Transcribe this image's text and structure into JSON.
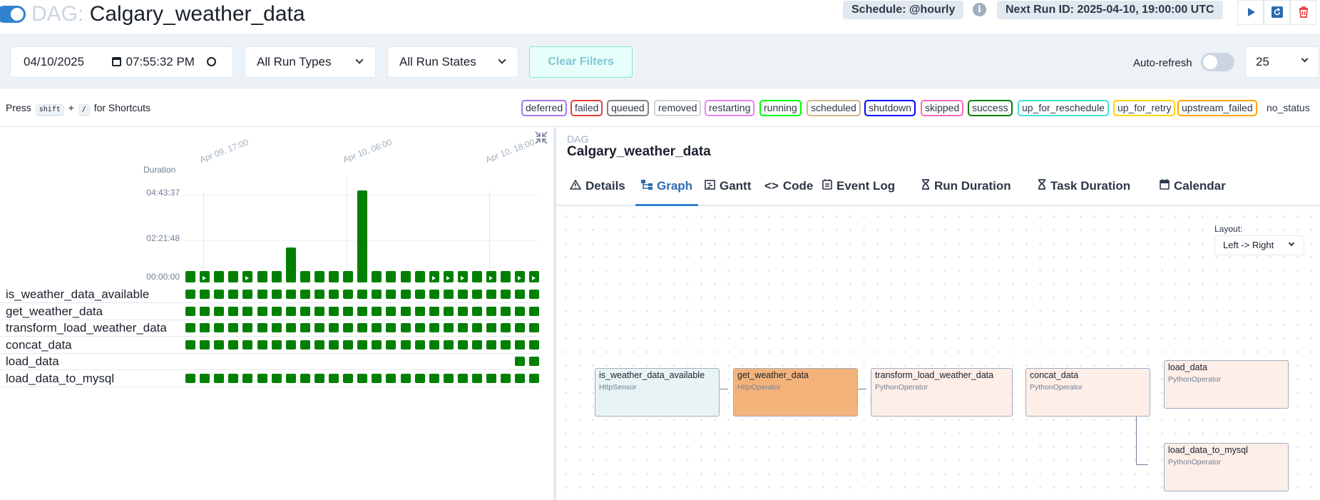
{
  "header": {
    "dag_label": "DAG:",
    "dag_id": "Calgary_weather_data",
    "schedule": "Schedule: @hourly",
    "next_run": "Next Run ID: 2025-04-10, 19:00:00 UTC",
    "info_icon": "i",
    "actions": [
      "play-icon",
      "reparse-icon",
      "delete-icon"
    ],
    "paused": false
  },
  "filters": {
    "date": "04/10/2025",
    "time": "07:55:32 PM",
    "run_types": "All Run Types",
    "run_states": "All Run States",
    "clear_label": "Clear Filters",
    "auto_refresh_label": "Auto-refresh",
    "auto_refresh_on": false,
    "num_runs": "25"
  },
  "shortcuts": {
    "press": "Press",
    "key1": "shift",
    "plus": "+",
    "key2": "/",
    "suffix": "for Shortcuts"
  },
  "legend": [
    {
      "label": "deferred",
      "color": "#9f7aea"
    },
    {
      "label": "failed",
      "color": "#e53e3e"
    },
    {
      "label": "queued",
      "color": "#808080"
    },
    {
      "label": "removed",
      "color": "#d3d3d3"
    },
    {
      "label": "restarting",
      "color": "#ee82ee"
    },
    {
      "label": "running",
      "color": "#00ff00"
    },
    {
      "label": "scheduled",
      "color": "#d2b48c"
    },
    {
      "label": "shutdown",
      "color": "#0000ff"
    },
    {
      "label": "skipped",
      "color": "#ff69b4"
    },
    {
      "label": "success",
      "color": "#008000"
    },
    {
      "label": "up_for_reschedule",
      "color": "#40e0d0"
    },
    {
      "label": "up_for_retry",
      "color": "#ffd700"
    },
    {
      "label": "upstream_failed",
      "color": "#ffa500"
    },
    {
      "label": "no_status",
      "color": ""
    }
  ],
  "grid": {
    "duration_label": "Duration",
    "y_ticks": [
      "04:43:37",
      "02:21:48",
      "00:00:00"
    ],
    "x_ticks": [
      "Apr 09, 17:00",
      "Apr 10, 06:00",
      "Apr 10, 18:00"
    ],
    "run_bars": [
      {
        "state": "success",
        "duration_frac": 0.07,
        "scheduled_icon": false
      },
      {
        "state": "success",
        "duration_frac": 0.07,
        "scheduled_icon": true
      },
      {
        "state": "success",
        "duration_frac": 0.07,
        "scheduled_icon": false
      },
      {
        "state": "success",
        "duration_frac": 0.07,
        "scheduled_icon": false
      },
      {
        "state": "success",
        "duration_frac": 0.07,
        "scheduled_icon": true
      },
      {
        "state": "success",
        "duration_frac": 0.07,
        "scheduled_icon": false
      },
      {
        "state": "success",
        "duration_frac": 0.07,
        "scheduled_icon": false
      },
      {
        "state": "success",
        "duration_frac": 0.38,
        "scheduled_icon": false
      },
      {
        "state": "success",
        "duration_frac": 0.07,
        "scheduled_icon": false
      },
      {
        "state": "success",
        "duration_frac": 0.07,
        "scheduled_icon": false
      },
      {
        "state": "success",
        "duration_frac": 0.07,
        "scheduled_icon": false
      },
      {
        "state": "success",
        "duration_frac": 0.07,
        "scheduled_icon": false
      },
      {
        "state": "success",
        "duration_frac": 0.99,
        "scheduled_icon": false
      },
      {
        "state": "success",
        "duration_frac": 0.07,
        "scheduled_icon": false
      },
      {
        "state": "success",
        "duration_frac": 0.07,
        "scheduled_icon": false
      },
      {
        "state": "success",
        "duration_frac": 0.07,
        "scheduled_icon": false
      },
      {
        "state": "success",
        "duration_frac": 0.07,
        "scheduled_icon": false
      },
      {
        "state": "success",
        "duration_frac": 0.07,
        "scheduled_icon": true
      },
      {
        "state": "success",
        "duration_frac": 0.07,
        "scheduled_icon": true
      },
      {
        "state": "success",
        "duration_frac": 0.07,
        "scheduled_icon": true
      },
      {
        "state": "success",
        "duration_frac": 0.07,
        "scheduled_icon": false
      },
      {
        "state": "success",
        "duration_frac": 0.07,
        "scheduled_icon": true
      },
      {
        "state": "success",
        "duration_frac": 0.07,
        "scheduled_icon": false
      },
      {
        "state": "success",
        "duration_frac": 0.07,
        "scheduled_icon": true
      },
      {
        "state": "success",
        "duration_frac": 0.07,
        "scheduled_icon": true
      }
    ],
    "tasks": [
      {
        "name": "is_weather_data_available",
        "runs": 25
      },
      {
        "name": "get_weather_data",
        "runs": 25
      },
      {
        "name": "transform_load_weather_data",
        "runs": 25
      },
      {
        "name": "concat_data",
        "runs": 25
      },
      {
        "name": "load_data",
        "runs": 2
      },
      {
        "name": "load_data_to_mysql",
        "runs": 25
      }
    ]
  },
  "details": {
    "crumb": "DAG",
    "dag_name": "Calgary_weather_data",
    "tabs": [
      {
        "label": "Details",
        "icon": "warning-icon",
        "active": false
      },
      {
        "label": "Graph",
        "icon": "graph-icon",
        "active": true
      },
      {
        "label": "Gantt",
        "icon": "gantt-icon",
        "active": false
      },
      {
        "label": "Code",
        "icon": "code-icon",
        "active": false
      },
      {
        "label": "Event Log",
        "icon": "log-icon",
        "active": false
      },
      {
        "label": "Run Duration",
        "icon": "hourglass-icon",
        "active": false
      },
      {
        "label": "Task Duration",
        "icon": "hourglass-icon",
        "active": false
      },
      {
        "label": "Calendar",
        "icon": "calendar-icon",
        "active": false
      }
    ],
    "layout_label": "Layout:",
    "layout_value": "Left -> Right",
    "nodes": [
      {
        "task": "is_weather_data_available",
        "operator": "HttpSensor",
        "color": "#e8f3f4"
      },
      {
        "task": "get_weather_data",
        "operator": "HttpOperator",
        "color": "#f4b37b"
      },
      {
        "task": "transform_load_weather_data",
        "operator": "PythonOperator",
        "color": "#fdeee8"
      },
      {
        "task": "concat_data",
        "operator": "PythonOperator",
        "color": "#fdeee8"
      },
      {
        "task": "load_data",
        "operator": "PythonOperator",
        "color": "#fdeee8"
      },
      {
        "task": "load_data_to_mysql",
        "operator": "PythonOperator",
        "color": "#fdeee8"
      }
    ]
  }
}
